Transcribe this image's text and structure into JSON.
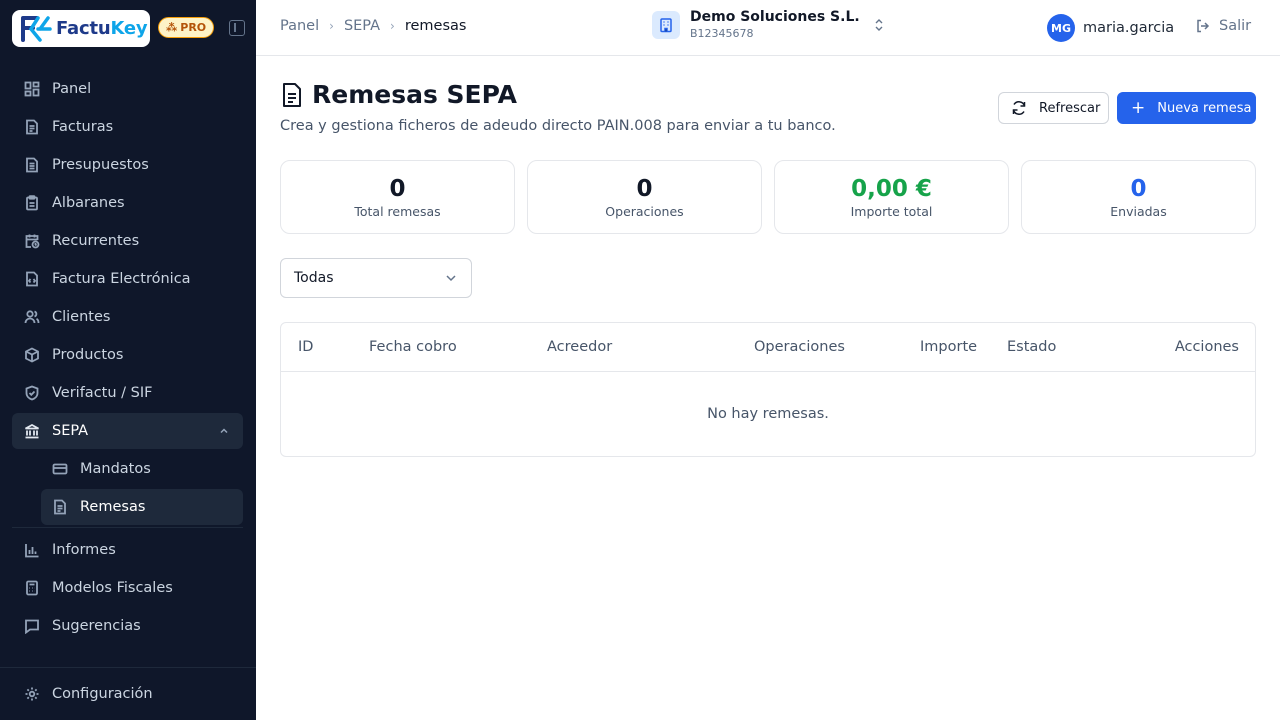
{
  "brand": {
    "name_a": "Factu",
    "name_b": "Key",
    "badge": "PRO"
  },
  "sidebar": {
    "items": [
      {
        "label": "Panel",
        "icon": "grid-icon"
      },
      {
        "label": "Facturas",
        "icon": "file-text-icon"
      },
      {
        "label": "Presupuestos",
        "icon": "file-list-icon"
      },
      {
        "label": "Albaranes",
        "icon": "clipboard-icon"
      },
      {
        "label": "Recurrentes",
        "icon": "calendar-clock-icon"
      },
      {
        "label": "Factura Electrónica",
        "icon": "file-code-icon"
      },
      {
        "label": "Clientes",
        "icon": "users-icon"
      },
      {
        "label": "Productos",
        "icon": "package-icon"
      },
      {
        "label": "Verifactu / SIF",
        "icon": "shield-check-icon"
      },
      {
        "label": "SEPA",
        "icon": "bank-icon"
      }
    ],
    "sepa_sub": [
      {
        "label": "Mandatos",
        "icon": "card-icon"
      },
      {
        "label": "Remesas",
        "icon": "file-text-icon"
      }
    ],
    "lower_items": [
      {
        "label": "Informes",
        "icon": "bar-chart-icon"
      },
      {
        "label": "Modelos Fiscales",
        "icon": "calculator-icon"
      },
      {
        "label": "Sugerencias",
        "icon": "message-icon"
      }
    ],
    "settings": {
      "label": "Configuración",
      "icon": "gear-icon"
    }
  },
  "header": {
    "breadcrumb": [
      "Panel",
      "SEPA",
      "remesas"
    ],
    "company": {
      "name": "Demo Soluciones S.L.",
      "nif": "B12345678"
    },
    "user": {
      "initials": "MG",
      "name": "maria.garcia"
    },
    "logout_label": "Salir"
  },
  "main": {
    "title": "Remesas SEPA",
    "subtitle": "Crea y gestiona ficheros de adeudo directo PAIN.008 para enviar a tu banco.",
    "refresh_label": "Refrescar",
    "new_label": "Nueva remesa",
    "stats": [
      {
        "value": "0",
        "label": "Total remesas"
      },
      {
        "value": "0",
        "label": "Operaciones"
      },
      {
        "value": "0,00 €",
        "label": "Importe total"
      },
      {
        "value": "0",
        "label": "Enviadas"
      }
    ],
    "filter_value": "Todas",
    "table": {
      "columns": [
        "ID",
        "Fecha cobro",
        "Acreedor",
        "Operaciones",
        "Importe",
        "Estado",
        "Acciones"
      ],
      "empty_text": "No hay remesas."
    }
  },
  "colors": {
    "accent": "#2563eb",
    "sidebar_bg": "#0f172a",
    "success": "#16a34a"
  }
}
